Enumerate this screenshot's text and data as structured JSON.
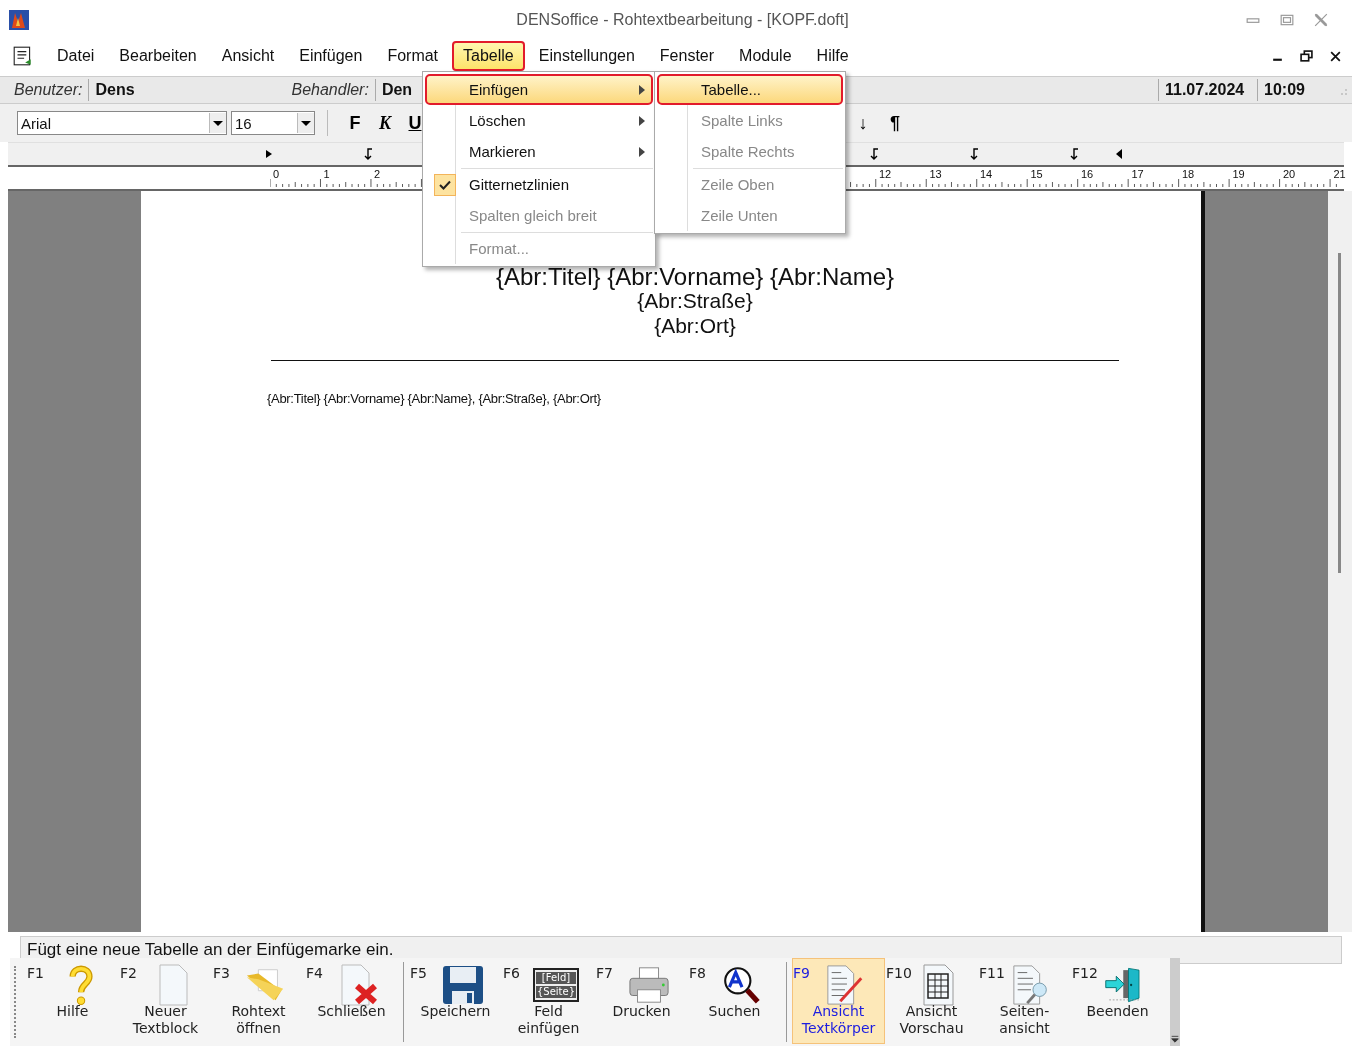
{
  "window": {
    "title": "DENSoffice - Rohtextbearbeitung - [KOPF.doft]"
  },
  "menu_bar": [
    {
      "label": "Datei",
      "selected": false
    },
    {
      "label": "Bearbeiten",
      "selected": false
    },
    {
      "label": "Ansicht",
      "selected": false
    },
    {
      "label": "Einfügen",
      "selected": false
    },
    {
      "label": "Format",
      "selected": false
    },
    {
      "label": "Tabelle",
      "selected": true
    },
    {
      "label": "Einstellungen",
      "selected": false
    },
    {
      "label": "Fenster",
      "selected": false
    },
    {
      "label": "Module",
      "selected": false
    },
    {
      "label": "Hilfe",
      "selected": false
    }
  ],
  "info_bar": {
    "user_label": "Benutzer:",
    "user": "Dens",
    "handler_label": "Behandler:",
    "handler": "Den",
    "date": "11.07.2024",
    "time": "10:09"
  },
  "format_toolbar": {
    "font": "Arial",
    "size": "16",
    "buttons": [
      {
        "label": "F",
        "kind": "bold"
      },
      {
        "label": "K",
        "kind": "italic"
      },
      {
        "label": "U",
        "kind": "underline"
      }
    ],
    "right_buttons": [
      "↓",
      "¶"
    ]
  },
  "ruler": {
    "left_labels": [
      "0",
      "1",
      "2"
    ],
    "right_labels": [
      "12",
      "13",
      "14",
      "15",
      "16",
      "17",
      "18",
      "19",
      "20",
      "21"
    ]
  },
  "document": {
    "lines": [
      "{Abr:Titel} {Abr:Vorname} {Abr:Name}",
      "{Abr:Straße}",
      "{Abr:Ort}"
    ],
    "body": "{Abr:Titel} {Abr:Vorname} {Abr:Name}, {Abr:Straße}, {Abr:Ort}"
  },
  "table_menu": [
    {
      "kind": "submenu",
      "label": "Einfügen",
      "selected": true,
      "disabled": false,
      "checked": false
    },
    {
      "kind": "submenu",
      "label": "Löschen",
      "selected": false,
      "disabled": false,
      "checked": false
    },
    {
      "kind": "submenu",
      "label": "Markieren",
      "selected": false,
      "disabled": false,
      "checked": false
    },
    {
      "kind": "separator"
    },
    {
      "kind": "item",
      "label": "Gitternetzlinien",
      "selected": false,
      "disabled": false,
      "checked": true
    },
    {
      "kind": "item",
      "label": "Spalten gleich breit",
      "selected": false,
      "disabled": true,
      "checked": false
    },
    {
      "kind": "separator"
    },
    {
      "kind": "item",
      "label": "Format...",
      "selected": false,
      "disabled": true,
      "checked": false
    }
  ],
  "insert_submenu": [
    {
      "kind": "item",
      "label": "Tabelle...",
      "selected": true,
      "disabled": false
    },
    {
      "kind": "item",
      "label": "Spalte Links",
      "selected": false,
      "disabled": true
    },
    {
      "kind": "item",
      "label": "Spalte Rechts",
      "selected": false,
      "disabled": true
    },
    {
      "kind": "separator"
    },
    {
      "kind": "item",
      "label": "Zeile Oben",
      "selected": false,
      "disabled": true
    },
    {
      "kind": "item",
      "label": "Zeile Unten",
      "selected": false,
      "disabled": true
    }
  ],
  "status_bar": "Fügt eine neue Tabelle an der Einfügemarke ein.",
  "function_keys": [
    [
      {
        "key": "F1",
        "label": "Hilfe",
        "selected": false
      },
      {
        "key": "F2",
        "label": "Neuer\nTextblock",
        "selected": false
      },
      {
        "key": "F3",
        "label": "Rohtext\nöffnen",
        "selected": false
      },
      {
        "key": "F4",
        "label": "Schließen",
        "selected": false
      }
    ],
    [
      {
        "key": "F5",
        "label": "Speichern",
        "selected": false
      },
      {
        "key": "F6",
        "label": "Feld\neinfügen",
        "selected": false,
        "icon_text": [
          "[Feld]",
          "{Seite}"
        ]
      },
      {
        "key": "F7",
        "label": "Drucken",
        "selected": false
      },
      {
        "key": "F8",
        "label": "Suchen",
        "selected": false
      }
    ],
    [
      {
        "key": "F9",
        "label": "Ansicht\nTextkörper",
        "selected": true
      },
      {
        "key": "F10",
        "label": "Ansicht\nVorschau",
        "selected": false
      },
      {
        "key": "F11",
        "label": "Seiten-\nansicht",
        "selected": false
      },
      {
        "key": "F12",
        "label": "Beenden",
        "selected": false
      }
    ]
  ]
}
